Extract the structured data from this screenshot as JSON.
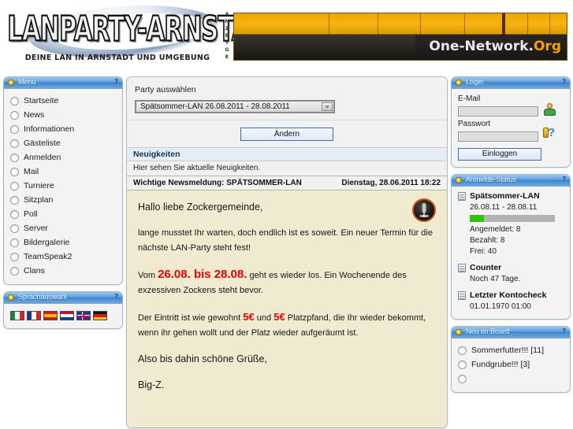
{
  "header": {
    "logo_text": "LANPARTY-ARNSTADT",
    "logo_subtitle": "DEINE LAN IN ARNSTADT UND UMGEBUNG",
    "ad_label": "ANZEIGE",
    "banner_text": "One-Network.",
    "banner_text_accent": "Org"
  },
  "colors": {
    "panel_header_blue": "#3f87d0",
    "news_background": "#f0ead0",
    "highlight_red": "#e60000",
    "progress_green": "#36c112",
    "banner_orange": "#f2a007"
  },
  "sidebar_left": {
    "menu": {
      "title": "Menu",
      "help": "?",
      "items": [
        {
          "label": "Startseite"
        },
        {
          "label": "News"
        },
        {
          "label": "Informationen"
        },
        {
          "label": "Gästeliste"
        },
        {
          "label": "Anmelden"
        },
        {
          "label": "Mail"
        },
        {
          "label": "Turniere"
        },
        {
          "label": "Sitzplan"
        },
        {
          "label": "Poll"
        },
        {
          "label": "Server"
        },
        {
          "label": "Bildergalerie"
        },
        {
          "label": "TeamSpeak2"
        },
        {
          "label": "Clans"
        }
      ]
    },
    "language": {
      "title": "Sprachauswahl",
      "help": "?",
      "flags": [
        {
          "name": "italy-flag"
        },
        {
          "name": "france-flag"
        },
        {
          "name": "spain-flag"
        },
        {
          "name": "netherlands-flag"
        },
        {
          "name": "united-kingdom-flag"
        },
        {
          "name": "germany-flag"
        }
      ]
    }
  },
  "main": {
    "party_select_label": "Party auswählen",
    "party_selected": "Spätsommer-LAN 26.08.2011 - 28.08.2011",
    "change_button": "Ändern",
    "news_section_title": "Neuigkeiten",
    "news_section_subtitle": "Hier sehen Sie aktuelle Neuigkeiten.",
    "news_headline": "Wichtige Newsmeldung: SPÄTSOMMER-LAN",
    "news_date": "Dienstag, 28.06.2011 18:22",
    "news_body": {
      "greeting": "Hallo liebe Zockergemeinde,",
      "p1": "lange musstet Ihr warten, doch endlich ist es soweit. Ein neuer Termin für die nächste LAN-Party steht fest!",
      "p2_pre": "Vom ",
      "p2_dates": "26.08. bis 28.08.",
      "p2_post": " geht es wieder los. Ein Wochenende des exzessiven Zockens steht bevor.",
      "p3_pre": "Der Eintritt ist wie gewohnt ",
      "p3_price1": "5€",
      "p3_mid": " und ",
      "p3_price2": "5€",
      "p3_post": " Platzpfand, die Ihr wieder bekommt, wenn ihr gehen wollt und der Platz wieder aufgeräumt ist.",
      "p4": "Also bis dahin schöne Grüße,",
      "p5": "Big-Z."
    }
  },
  "sidebar_right": {
    "login": {
      "title": "Login",
      "help": "?",
      "email_label": "E-Mail",
      "email_value": "",
      "password_label": "Passwort",
      "password_value": "",
      "submit_label": "Einloggen"
    },
    "status": {
      "title": "Anmelde-Status",
      "help": "?",
      "party_name": "Spätsommer-LAN",
      "party_dates": "26.08.11 - 28.08.11",
      "progress_percent": 17,
      "registered": "Angemeldet: 8",
      "paid": "Bezahlt: 8",
      "free": "Frei: 40",
      "counter_title": "Counter",
      "counter_value": "Noch 47 Tage.",
      "account_title": "Letzter Kontocheck",
      "account_value": "01.01.1970 01:00"
    },
    "board": {
      "title": "Neu im Board",
      "help": "?",
      "items": [
        {
          "label": "Sommerfutter!!! [11]"
        },
        {
          "label": "Fundgrube!!! [3]"
        }
      ]
    }
  }
}
